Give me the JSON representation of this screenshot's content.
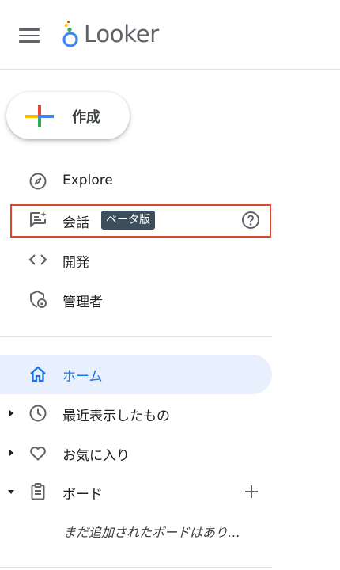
{
  "header": {
    "logo_text": "Looker",
    "menu_icon": "hamburger-icon"
  },
  "create": {
    "label": "作成",
    "icon": "plus-multicolor-icon"
  },
  "nav": {
    "explore": {
      "label": "Explore",
      "icon": "compass-icon"
    },
    "conversations": {
      "label": "会話",
      "badge": "ベータ版",
      "icon": "chat-sparkle-icon",
      "help_icon": "help-circle-icon"
    },
    "develop": {
      "label": "開発",
      "icon": "code-icon"
    },
    "admin": {
      "label": "管理者",
      "icon": "shield-lock-icon"
    }
  },
  "sections": {
    "home": {
      "label": "ホーム",
      "icon": "home-icon"
    },
    "recent": {
      "label": "最近表示したもの",
      "icon": "clock-icon"
    },
    "favorites": {
      "label": "お気に入り",
      "icon": "heart-icon"
    },
    "boards": {
      "label": "ボード",
      "icon": "clipboard-icon",
      "empty_message": "まだ追加されたボードはあり…"
    }
  },
  "colors": {
    "highlight_border": "#d9472b",
    "active_bg": "#e8f0fe",
    "active_text": "#1a73e8",
    "badge_bg": "#3c4e5c"
  }
}
